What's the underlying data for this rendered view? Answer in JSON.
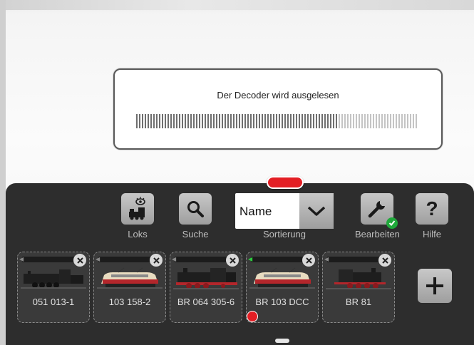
{
  "dialog": {
    "title": "Der Decoder wird ausgelesen",
    "progress": 0.72
  },
  "toolbar": {
    "loks_label": "Loks",
    "suche_label": "Suche",
    "sort_value": "Name",
    "sort_label": "Sortierung",
    "bearbeiten_label": "Bearbeiten",
    "hilfe_label": "Hilfe",
    "hilfe_glyph": "?"
  },
  "locos": [
    {
      "name": "051 013-1",
      "type": "steam"
    },
    {
      "name": "103 158-2",
      "type": "electric"
    },
    {
      "name": "BR 064 305-6",
      "type": "steam-red"
    },
    {
      "name": "BR 103 DCC",
      "type": "electric",
      "active": true,
      "status": "error"
    },
    {
      "name": "BR 81",
      "type": "steam-red"
    }
  ],
  "colors": {
    "accent": "#e31e24",
    "panel": "#2d2d2d",
    "ok": "#1fa83a"
  }
}
